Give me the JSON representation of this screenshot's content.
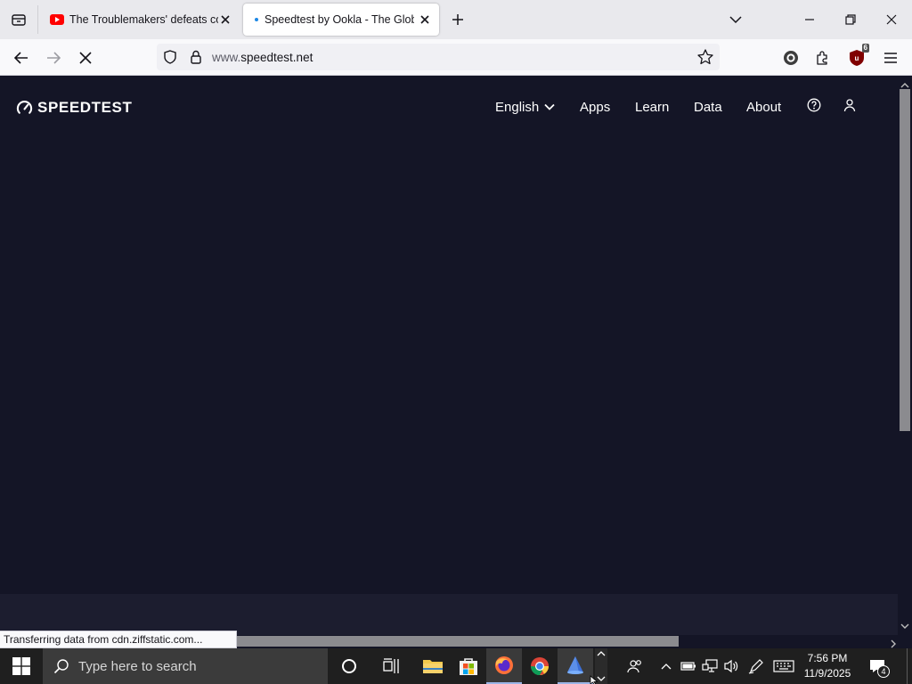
{
  "browser": {
    "tabs": [
      {
        "title": "The Troublemakers' defeats com",
        "favicon": "youtube-icon",
        "active": false
      },
      {
        "title": "Speedtest by Ookla - The Global",
        "favicon": "loading-dot-icon",
        "active": true
      }
    ],
    "url_prefix": "www.",
    "url_domain": "speedtest.net",
    "ublock_badge": "6",
    "status": "Transferring data from cdn.ziffstatic.com..."
  },
  "site": {
    "logo_text": "SPEEDTEST",
    "nav": {
      "language": "English",
      "apps": "Apps",
      "learn": "Learn",
      "data": "Data",
      "about": "About"
    }
  },
  "taskbar": {
    "search_placeholder": "Type here to search",
    "time": "7:56 PM",
    "date": "11/9/2025",
    "notification_count": "4"
  },
  "colors": {
    "page_background": "#141526",
    "footer_band": "#1c1d2f",
    "youtube_red": "#ff0000",
    "speedtest_loading_dot": "#1e88e5"
  }
}
